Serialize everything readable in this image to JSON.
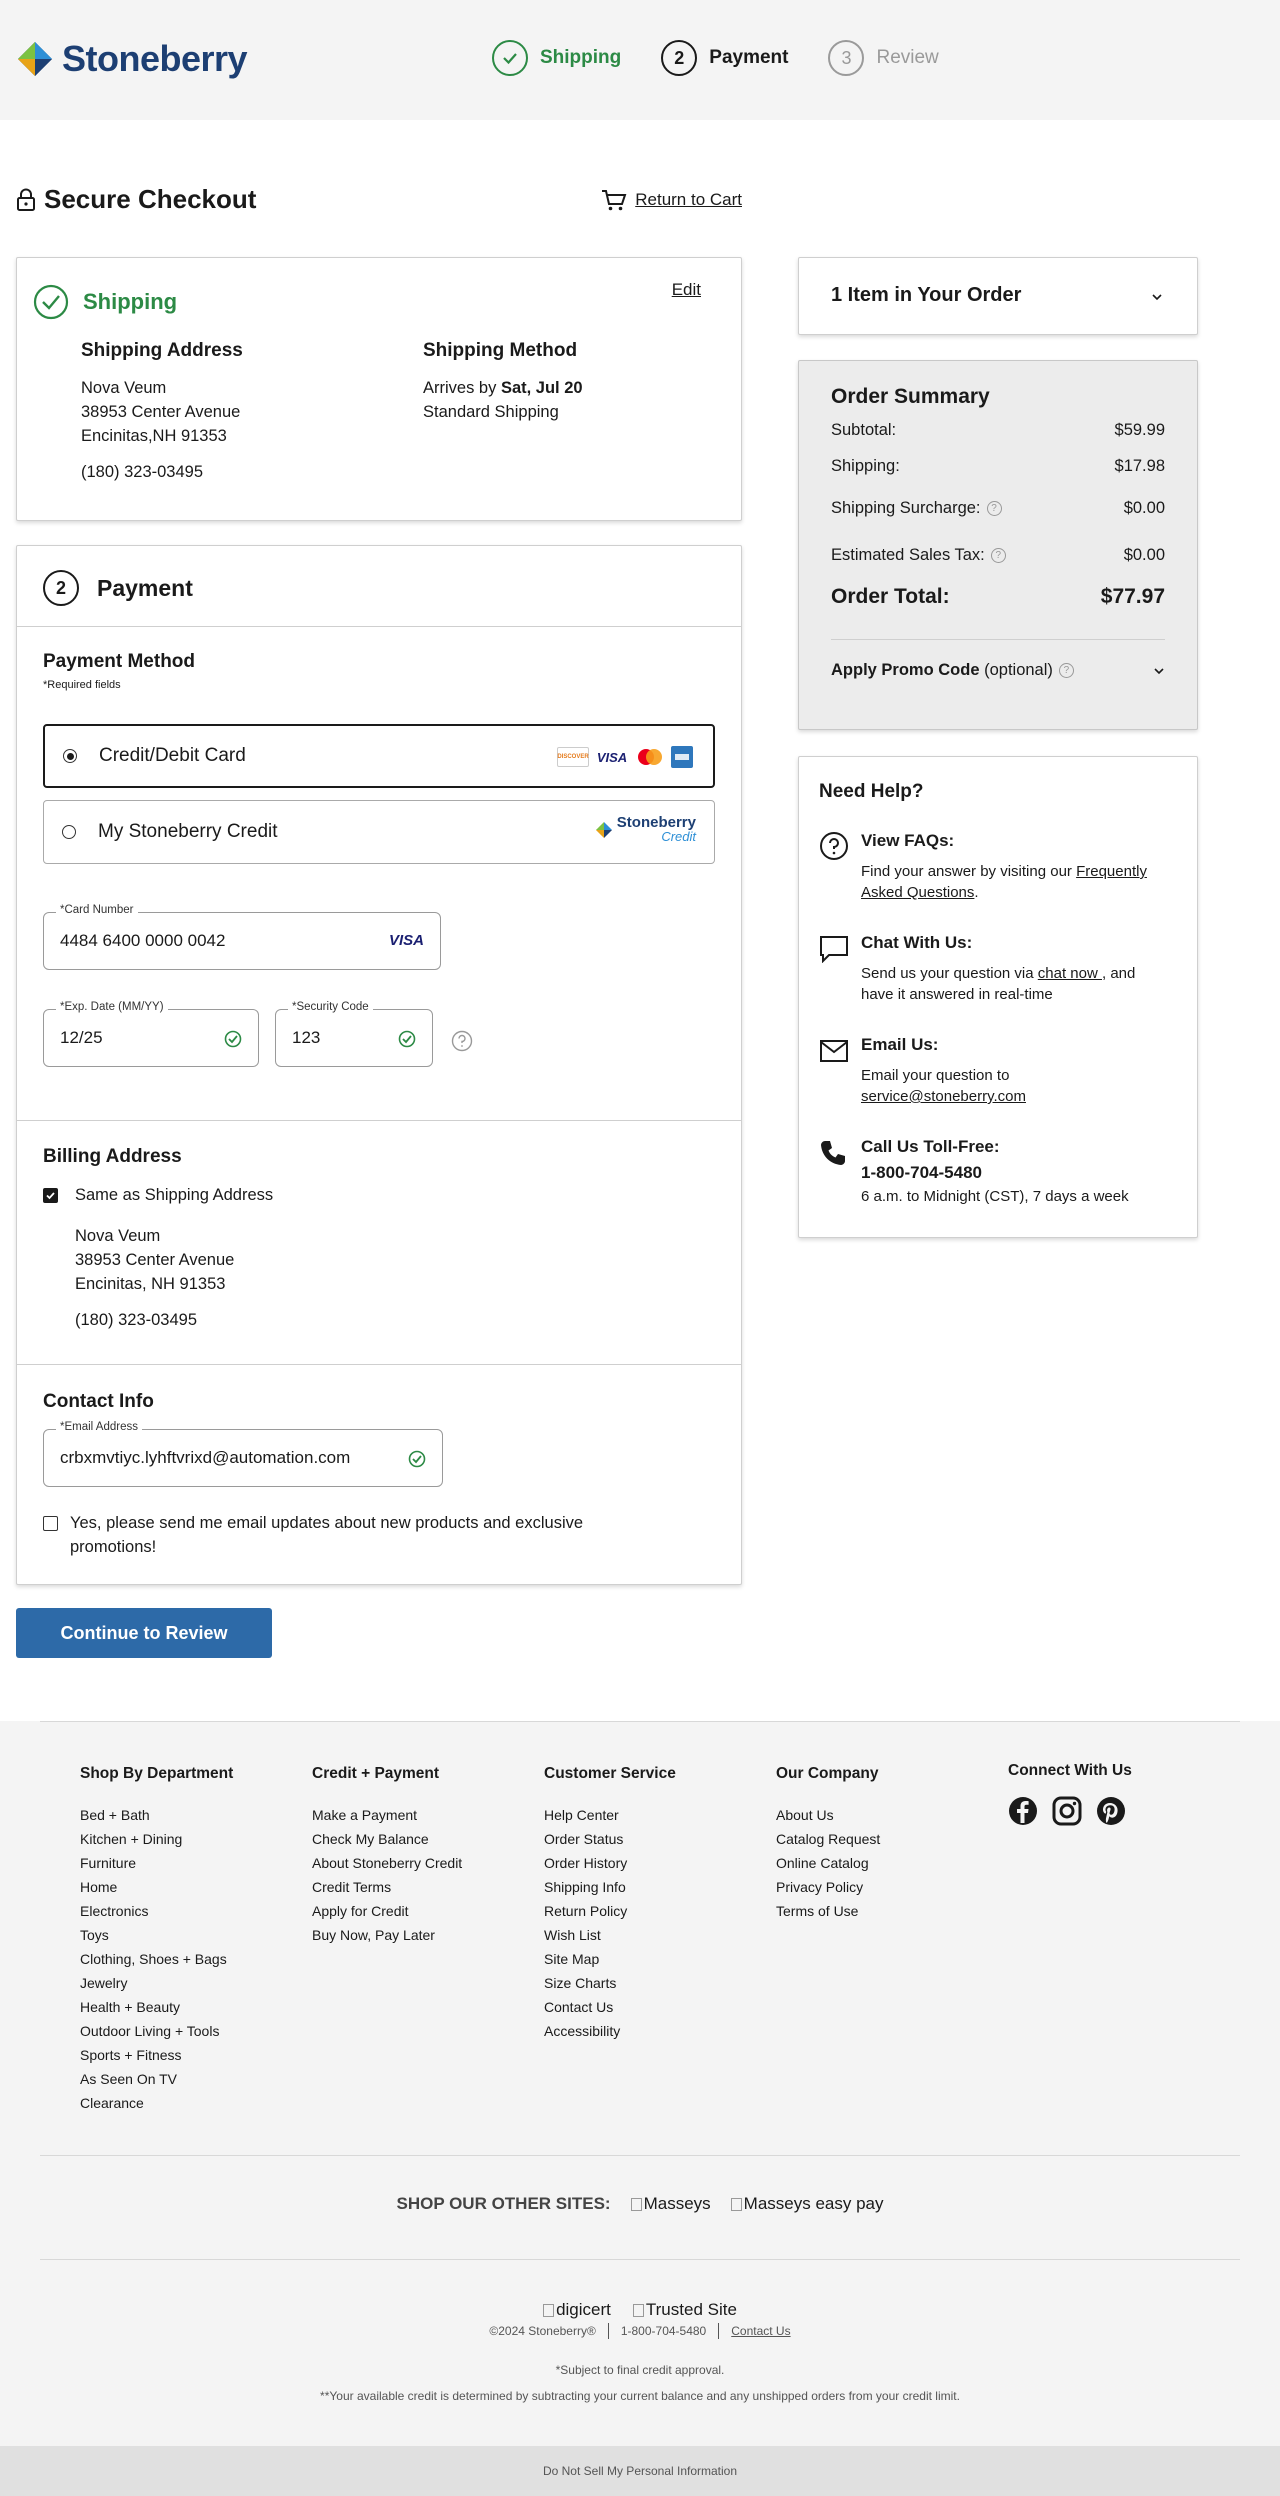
{
  "brand": {
    "name": "Stoneberry"
  },
  "steps": [
    {
      "num": "",
      "label": "Shipping"
    },
    {
      "num": "2",
      "label": "Payment"
    },
    {
      "num": "3",
      "label": "Review"
    }
  ],
  "page": {
    "title": "Secure Checkout",
    "return_cart": "Return to Cart"
  },
  "shipping": {
    "header": "Shipping",
    "edit": "Edit",
    "address_title": "Shipping Address",
    "address_lines": [
      "Nova Veum",
      "38953 Center Avenue",
      "Encinitas,NH 91353"
    ],
    "phone": "(180) 323-03495",
    "method_title": "Shipping Method",
    "arrives_prefix": "Arrives by ",
    "arrives_date": "Sat, Jul 20",
    "method_name": "Standard Shipping"
  },
  "payment": {
    "step_num": "2",
    "header": "Payment",
    "method_title": "Payment Method",
    "required_note": "*Required fields",
    "option_card": "Credit/Debit Card",
    "option_credit": "My Stoneberry Credit",
    "credit_logo": {
      "line1": "Stoneberry",
      "line2": "Credit"
    },
    "card_logos": {
      "discover": "DISCOVER",
      "visa": "VISA"
    },
    "card_number_label": "*Card Number",
    "card_number": "4484 6400 0000 0042",
    "card_brand": "VISA",
    "exp_label": "*Exp. Date (MM/YY)",
    "exp_value": "12/25",
    "cvv_label": "*Security Code",
    "cvv_value": "123"
  },
  "billing": {
    "title": "Billing Address",
    "same_label": "Same as Shipping Address",
    "address_lines": [
      "Nova Veum",
      "38953 Center Avenue",
      "Encinitas, NH 91353"
    ],
    "phone": "(180) 323-03495"
  },
  "contact": {
    "title": "Contact Info",
    "email_label": "*Email Address",
    "email": "crbxmvtiyc.lyhftvrixd@automation.com",
    "optin_line1": "Yes, please send me email updates about new products and exclusive",
    "optin_line2": "promotions!"
  },
  "continue_button": "Continue to Review",
  "order": {
    "items_label": "1 Item in Your Order",
    "summary_title": "Order Summary",
    "subtotal_label": "Subtotal:",
    "subtotal": "$59.99",
    "shipping_label": "Shipping:",
    "shipping": "$17.98",
    "surcharge_label": "Shipping Surcharge:",
    "surcharge": "$0.00",
    "tax_label": "Estimated Sales Tax:",
    "tax": "$0.00",
    "total_label": "Order Total:",
    "total": "$77.97",
    "promo_label": "Apply Promo Code",
    "promo_optional": "(optional)"
  },
  "help": {
    "title": "Need Help?",
    "faq_title": "View FAQs:",
    "faq_text": "Find your answer by visiting our ",
    "faq_link_1": "Frequently",
    "faq_link_2": "Asked Questions",
    "chat_title": "Chat With Us:",
    "chat_text_1": "Send us your question via ",
    "chat_link": "chat now ",
    "chat_text_2": ", and",
    "chat_text_3": "have it answered in real-time",
    "email_title": "Email Us:",
    "email_text": "Email your question to",
    "email_link": "service@stoneberry.com",
    "call_title": "Call Us Toll-Free:",
    "call_number": "1-800-704-5480",
    "call_hours": "6 a.m. to Midnight (CST), 7 days a week"
  },
  "footer": {
    "columns": [
      {
        "title": "Shop By Department",
        "links": [
          "Bed + Bath",
          "Kitchen + Dining",
          "Furniture",
          "Home",
          "Electronics",
          "Toys",
          "Clothing, Shoes + Bags",
          "Jewelry",
          "Health + Beauty",
          "Outdoor Living + Tools",
          "Sports + Fitness",
          "As Seen On TV",
          "Clearance"
        ]
      },
      {
        "title": "Credit + Payment",
        "links": [
          "Make a Payment",
          "Check My Balance",
          "About Stoneberry Credit",
          "Credit Terms",
          "Apply for Credit",
          "Buy Now, Pay Later"
        ]
      },
      {
        "title": "Customer Service",
        "links": [
          "Help Center",
          "Order Status",
          "Order History",
          "Shipping Info",
          "Return Policy",
          "Wish List",
          "Site Map",
          "Size Charts",
          "Contact Us",
          "Accessibility"
        ]
      },
      {
        "title": "Our Company",
        "links": [
          "About Us",
          "Catalog Request",
          "Online Catalog",
          "Privacy Policy",
          "Terms of Use"
        ]
      }
    ],
    "connect_title": "Connect With Us",
    "other_sites_label": "SHOP OUR OTHER SITES:",
    "site_1": "Masseys",
    "site_2": "Masseys easy pay",
    "badge_1": "digicert",
    "badge_2": "Trusted Site",
    "copyright": "©2024 Stoneberry®",
    "phone": "1-800-704-5480",
    "contact_link": "Contact Us",
    "note_1": "*Subject to final credit approval.",
    "note_2": "**Your available credit is determined by subtracting your current balance and any unshipped orders from your credit limit.",
    "do_not_sell": "Do Not Sell My Personal Information"
  },
  "colors": {
    "brand_blue": "#2d6aa8",
    "success_green": "#2c8a45",
    "logo_navy": "#1d3f73"
  }
}
